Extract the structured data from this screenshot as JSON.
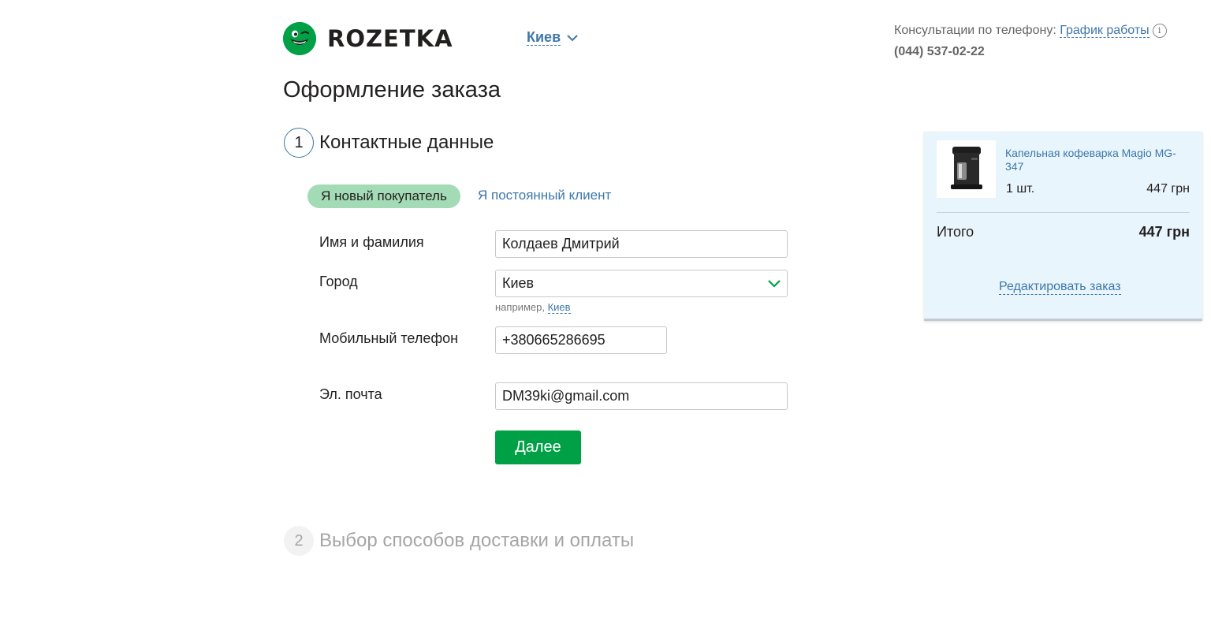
{
  "header": {
    "logo_text": "ROZETKA",
    "city": "Киев",
    "consult_label": "Консультации по телефону:",
    "schedule_link": "График работы",
    "info_icon_glyph": "i",
    "phone": "(044) 537-02-22"
  },
  "page": {
    "title": "Оформление заказа"
  },
  "steps": [
    {
      "number": "1",
      "title": "Контактные данные"
    },
    {
      "number": "2",
      "title": "Выбор способов доставки и оплаты"
    }
  ],
  "tabs": {
    "new_customer": "Я новый покупатель",
    "regular_customer": "Я постоянный клиент"
  },
  "form": {
    "name_label": "Имя и фамилия",
    "name_value": "Колдаев Дмитрий",
    "city_label": "Город",
    "city_value": "Киев",
    "city_hint_prefix": "например,",
    "city_hint_link": "Киев",
    "phone_label": "Мобильный телефон",
    "phone_value": "+380665286695",
    "email_label": "Эл. почта",
    "email_value": "DM39ki@gmail.com",
    "next_button": "Далее"
  },
  "cart": {
    "item_name": "Капельная кофеварка Magio MG-347",
    "quantity": "1 шт.",
    "price": "447 грн",
    "total_label": "Итого",
    "total_value": "447 грн",
    "edit_link": "Редактировать заказ"
  },
  "colors": {
    "brand_green": "#00a046",
    "link_blue": "#3e77aa",
    "tab_active_bg": "#a3dbb6",
    "cart_bg": "#e9f5fc"
  },
  "icons": [
    "rozetka-logo-icon",
    "chevron-down-icon",
    "info-icon",
    "coffee-maker-image"
  ]
}
